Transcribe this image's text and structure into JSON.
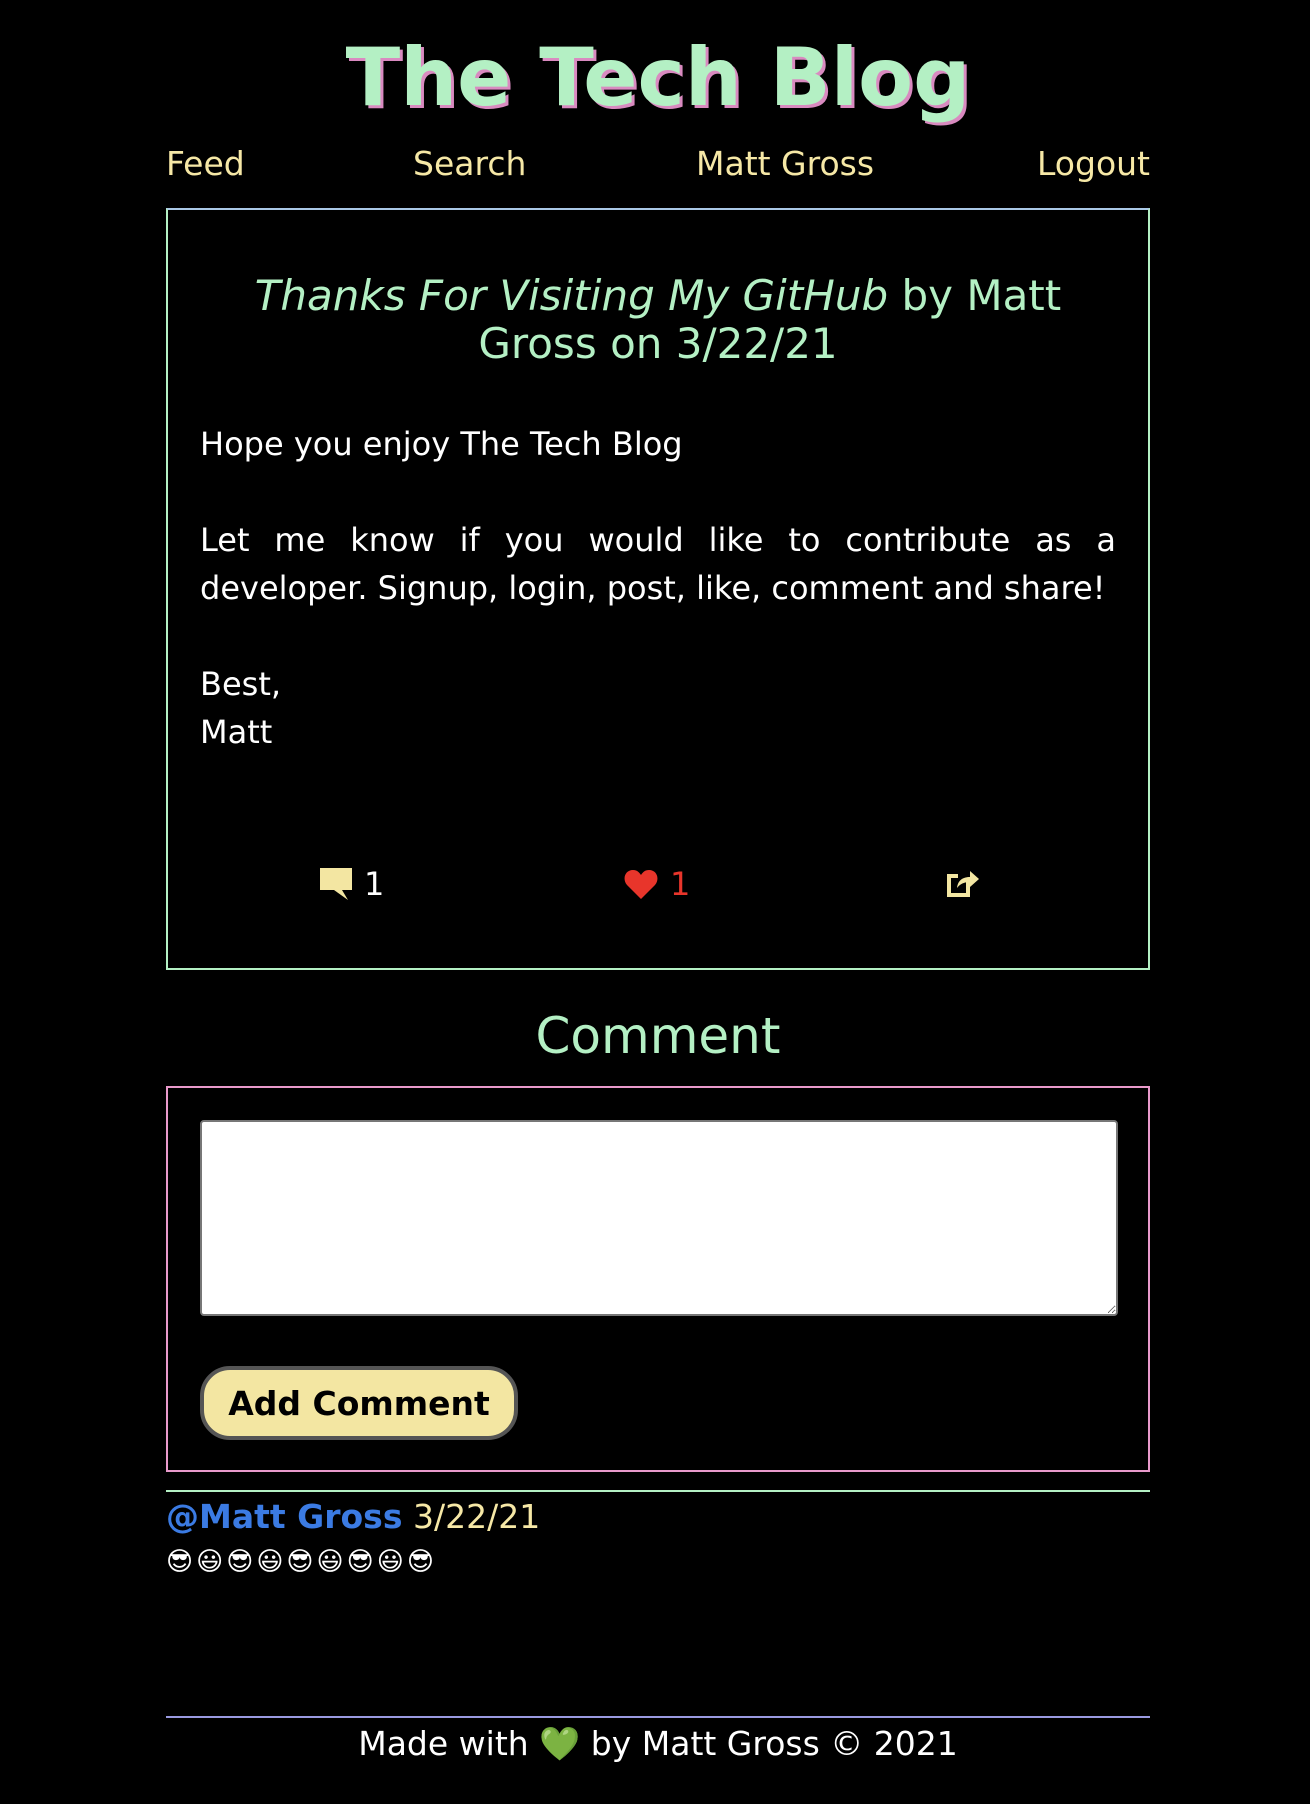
{
  "site": {
    "title": "The Tech Blog"
  },
  "nav": {
    "feed": "Feed",
    "search": "Search",
    "user": "Matt Gross",
    "logout": "Logout"
  },
  "post": {
    "title": "Thanks For Visiting My GitHub",
    "by_text": "by Matt Gross",
    "on_text": "on 3/22/21",
    "paragraph_1": "Hope you enjoy The Tech Blog",
    "paragraph_2": "Let me know if you would like to contribute as a developer. Signup, login, post, like, comment and share!",
    "closing": "Best,",
    "signature": "Matt",
    "comment_count": "1",
    "like_count": "1",
    "icons": {
      "comment": "comment-icon",
      "like": "heart-icon",
      "share": "share-icon"
    }
  },
  "comment_section": {
    "heading": "Comment",
    "textarea_value": "",
    "add_button": "Add Comment"
  },
  "comments": [
    {
      "author": "@Matt Gross",
      "date": "3/22/21",
      "text": "😎😃😎😃😎😃😎😃😎"
    }
  ],
  "footer": {
    "text_before": "Made with",
    "heart": "💚",
    "text_after": "by Matt Gross © 2021"
  },
  "colors": {
    "background": "#000000",
    "accent_green": "#b4f0c4",
    "nav_yellow": "#f6e8a6",
    "like_red": "#e8352b",
    "author_blue": "#3b7be3",
    "form_border_pink": "#e99acb",
    "footer_line": "#9a9ae0"
  }
}
